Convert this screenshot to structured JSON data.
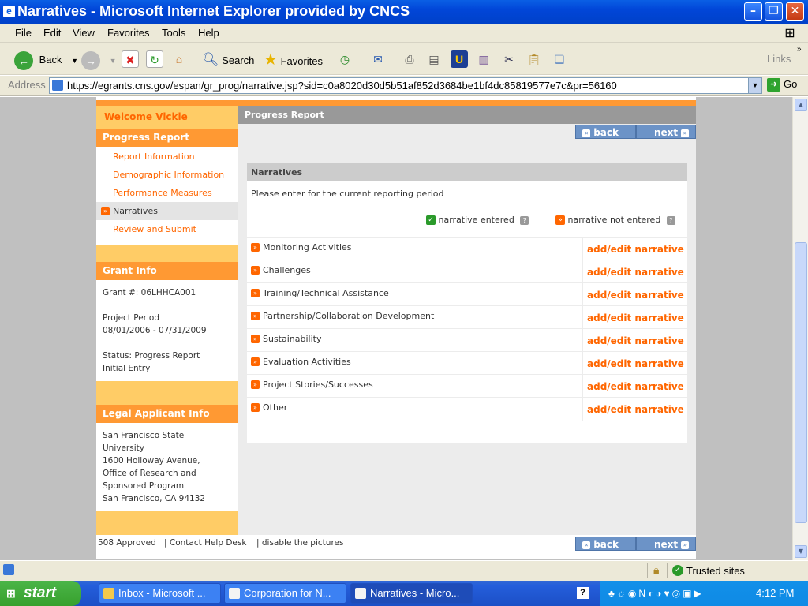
{
  "window": {
    "title": "Narratives - Microsoft Internet Explorer provided by CNCS"
  },
  "menu": [
    "File",
    "Edit",
    "View",
    "Favorites",
    "Tools",
    "Help"
  ],
  "toolbar": {
    "back": "Back",
    "search": "Search",
    "favorites": "Favorites",
    "links": "Links"
  },
  "address": {
    "label": "Address",
    "url": "https://egrants.cns.gov/espan/gr_prog/narrative.jsp?sid=c0a8020d30d5b51af852d3684be1bf4dc85819577e7c&pr=56160",
    "go": "Go"
  },
  "sidebar": {
    "welcome": "Welcome Vickie",
    "progress_title": "Progress Report",
    "links": [
      "Report Information",
      "Demographic Information",
      "Performance Measures",
      "Narratives",
      "Review and Submit"
    ],
    "grant_title": "Grant Info",
    "grant_number": "Grant #: 06LHHCA001",
    "project_period_label": "Project Period",
    "project_period": "08/01/2006 - 07/31/2009",
    "status_line1": "Status: Progress Report",
    "status_line2": "Initial Entry",
    "legal_title": "Legal Applicant Info",
    "legal_lines": [
      "San Francisco State",
      "University",
      "1600 Holloway Avenue,",
      "Office of Research and",
      "Sponsored Program",
      "San Francisco, CA 94132"
    ]
  },
  "main": {
    "header": "Progress Report",
    "back": "back",
    "next": "next",
    "narratives_title": "Narratives",
    "instruction": "Please enter for the current reporting period",
    "legend_entered": "narrative entered",
    "legend_not_entered": "narrative not entered",
    "rows": [
      {
        "label": "Monitoring Activities",
        "action": "add/edit narrative"
      },
      {
        "label": "Challenges",
        "action": "add/edit narrative"
      },
      {
        "label": "Training/Technical Assistance",
        "action": "add/edit narrative"
      },
      {
        "label": "Partnership/Collaboration Development",
        "action": "add/edit narrative"
      },
      {
        "label": "Sustainability",
        "action": "add/edit narrative"
      },
      {
        "label": "Evaluation Activities",
        "action": "add/edit narrative"
      },
      {
        "label": "Project Stories/Successes",
        "action": "add/edit narrative"
      },
      {
        "label": "Other",
        "action": "add/edit narrative"
      }
    ]
  },
  "footer": {
    "approved": "508 Approved",
    "help": "| Contact Help Desk",
    "pictures": "| disable the pictures",
    "back": "back",
    "next": "next"
  },
  "status": {
    "zone": "Trusted sites"
  },
  "taskbar": {
    "start": "start",
    "buttons": [
      "Inbox - Microsoft ...",
      "Corporation for N...",
      "Narratives - Micro..."
    ],
    "clock": "4:12 PM"
  },
  "colors": {
    "accent": "#ff6600",
    "sidebar": "#ffcc66",
    "header": "#ff9933",
    "button": "#6c93c7"
  }
}
